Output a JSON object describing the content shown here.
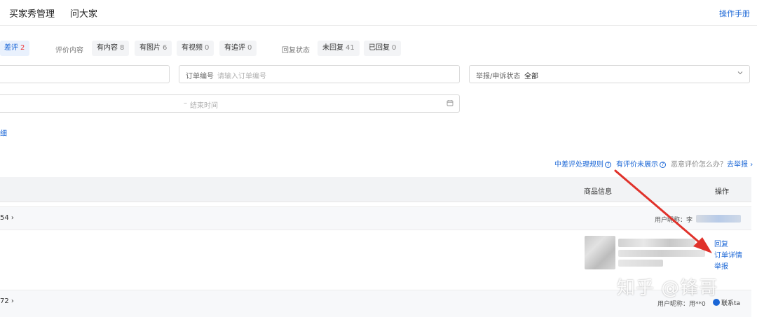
{
  "nav": {
    "tabs": [
      "买家秀管理",
      "问大家"
    ],
    "manual": "操作手册"
  },
  "filters": {
    "rating_chip": {
      "label": "差评",
      "count": "2"
    },
    "content_group_label": "评价内容",
    "content_chips": [
      {
        "label": "有内容",
        "count": "8"
      },
      {
        "label": "有图片",
        "count": "6"
      },
      {
        "label": "有视频",
        "count": "0"
      },
      {
        "label": "有追评",
        "count": "0"
      }
    ],
    "reply_group_label": "回复状态",
    "reply_chips": [
      {
        "label": "未回复",
        "count": "41"
      },
      {
        "label": "已回复",
        "count": "0"
      }
    ]
  },
  "search": {
    "order_label": "订单编号",
    "order_placeholder": "请输入订单编号",
    "report_label": "举报/申诉状态",
    "report_value": "全部",
    "end_time_placeholder": "结束时间",
    "range_sep": "–"
  },
  "detail_link": "细",
  "help": {
    "rules": "中差评处理规则",
    "not_shown": "有评价未展示",
    "malicious": "恶意评价怎么办？",
    "report_link": "去举报",
    "report_arrow": "›"
  },
  "table": {
    "col_product": "商品信息",
    "col_ops": "操作"
  },
  "orders": [
    {
      "no": "54",
      "nick": "用户昵称：李",
      "ops": [
        "回复",
        "订单详情",
        "举报"
      ]
    },
    {
      "no": "72",
      "nick": "用户昵称：用**0",
      "contact": "联系ta"
    }
  ],
  "watermark": "知乎 @锋哥",
  "colors": {
    "accent": "#1a66d6",
    "badge_red": "#e33333",
    "arrow_red": "#e0322b"
  },
  "icons": [
    "calendar-icon",
    "chevron-down-icon",
    "question-circle-icon",
    "user-avatar-icon",
    "red-arrow-annotation"
  ]
}
